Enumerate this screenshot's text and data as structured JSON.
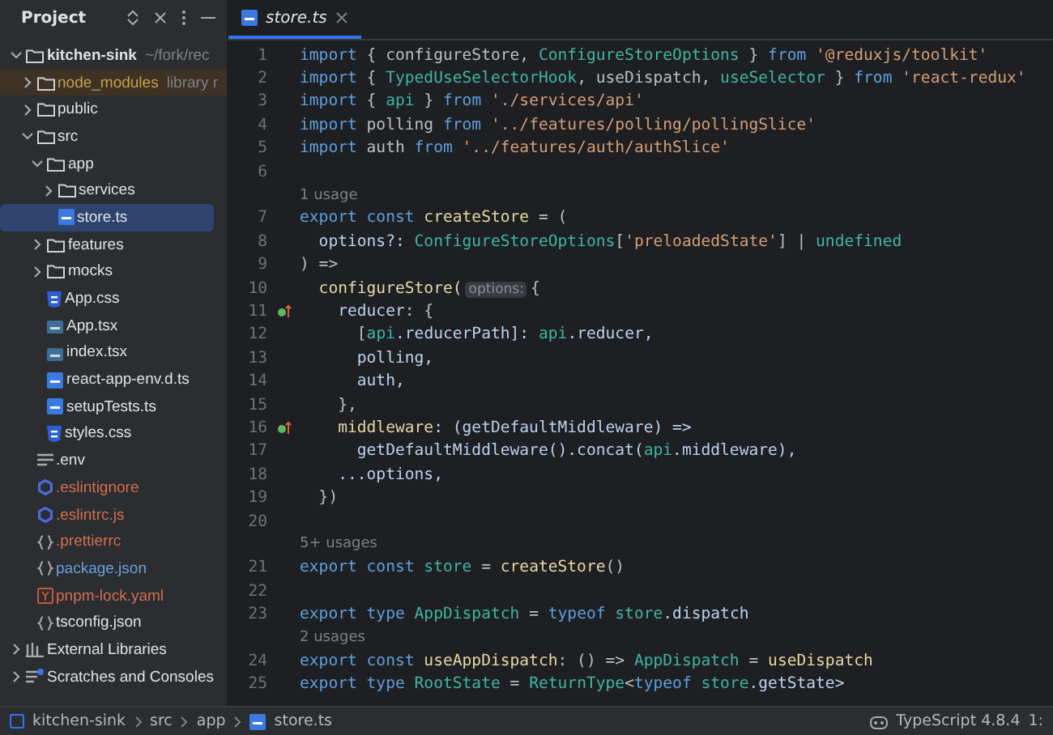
{
  "project_panel": {
    "title": "Project",
    "tree": [
      {
        "label": "kitchen-sink",
        "hint": "~/fork/rec",
        "kind": "folder",
        "expanded": true,
        "selected": false,
        "color": "#dfe1e5",
        "children": [
          {
            "label": "node_modules",
            "hint": "library r",
            "kind": "folder",
            "expanded": false,
            "selected": false,
            "excluded": true,
            "color": "#c4a24f"
          },
          {
            "label": "public",
            "kind": "folder",
            "expanded": false,
            "selected": false,
            "color": "#dfe1e5"
          },
          {
            "label": "src",
            "kind": "folder",
            "expanded": true,
            "selected": false,
            "color": "#dfe1e5",
            "children": [
              {
                "label": "app",
                "kind": "folder",
                "expanded": true,
                "selected": false,
                "color": "#dfe1e5",
                "children": [
                  {
                    "label": "services",
                    "kind": "folder",
                    "expanded": false,
                    "selected": false,
                    "color": "#dfe1e5"
                  },
                  {
                    "label": "store.ts",
                    "kind": "ts",
                    "selected": true,
                    "color": "#dfe1e5"
                  }
                ]
              },
              {
                "label": "features",
                "kind": "folder",
                "expanded": false,
                "selected": false,
                "color": "#dfe1e5"
              },
              {
                "label": "mocks",
                "kind": "folder",
                "expanded": false,
                "selected": false,
                "color": "#dfe1e5"
              },
              {
                "label": "App.css",
                "kind": "css",
                "selected": false,
                "color": "#dfe1e5"
              },
              {
                "label": "App.tsx",
                "kind": "tsx",
                "selected": false,
                "color": "#dfe1e5"
              },
              {
                "label": "index.tsx",
                "kind": "tsx",
                "selected": false,
                "color": "#dfe1e5"
              },
              {
                "label": "react-app-env.d.ts",
                "kind": "ts",
                "selected": false,
                "color": "#dfe1e5"
              },
              {
                "label": "setupTests.ts",
                "kind": "ts",
                "selected": false,
                "color": "#dfe1e5"
              },
              {
                "label": "styles.css",
                "kind": "css",
                "selected": false,
                "color": "#dfe1e5"
              }
            ]
          },
          {
            "label": ".env",
            "kind": "text",
            "selected": false,
            "color": "#dfe1e5"
          },
          {
            "label": ".eslintignore",
            "kind": "eslint",
            "selected": false,
            "color": "#d2704f"
          },
          {
            "label": ".eslintrc.js",
            "kind": "eslint",
            "selected": false,
            "color": "#d2704f"
          },
          {
            "label": ".prettierrc",
            "kind": "json",
            "selected": false,
            "color": "#d2704f"
          },
          {
            "label": "package.json",
            "kind": "json",
            "selected": false,
            "color": "#6c9fe0"
          },
          {
            "label": "pnpm-lock.yaml",
            "kind": "yaml",
            "selected": false,
            "color": "#d2704f"
          },
          {
            "label": "tsconfig.json",
            "kind": "json",
            "selected": false,
            "color": "#dfe1e5"
          }
        ]
      },
      {
        "label": "External Libraries",
        "kind": "library",
        "expanded": false,
        "selected": false,
        "color": "#dfe1e5"
      },
      {
        "label": "Scratches and Consoles",
        "kind": "scratch",
        "expanded": false,
        "selected": false,
        "color": "#dfe1e5"
      }
    ]
  },
  "editor_tabs": [
    {
      "label": "store.ts",
      "selected": true
    }
  ],
  "code": [
    {
      "kind": "code",
      "number": "1",
      "marker": false,
      "tokens": [
        {
          "text": "import",
          "kind": "kw"
        },
        {
          "text": " { configureStore, ",
          "kind": "plain"
        },
        {
          "text": "ConfigureStoreOptions",
          "kind": "type"
        },
        {
          "text": " } ",
          "kind": "plain"
        },
        {
          "text": "from",
          "kind": "kw"
        },
        {
          "text": " '@reduxjs/toolkit'",
          "kind": "str"
        }
      ]
    },
    {
      "kind": "code",
      "number": "2",
      "marker": false,
      "tokens": [
        {
          "text": "import",
          "kind": "kw"
        },
        {
          "text": " { ",
          "kind": "plain"
        },
        {
          "text": "TypedUseSelectorHook",
          "kind": "type"
        },
        {
          "text": ", useDispatch, ",
          "kind": "plain"
        },
        {
          "text": "useSelector",
          "kind": "type"
        },
        {
          "text": " } ",
          "kind": "plain"
        },
        {
          "text": "from",
          "kind": "kw"
        },
        {
          "text": " 'react-redux'",
          "kind": "str"
        }
      ]
    },
    {
      "kind": "code",
      "number": "3",
      "marker": false,
      "tokens": [
        {
          "text": "import",
          "kind": "kw"
        },
        {
          "text": " { ",
          "kind": "plain"
        },
        {
          "text": "api",
          "kind": "type"
        },
        {
          "text": " } ",
          "kind": "plain"
        },
        {
          "text": "from",
          "kind": "kw"
        },
        {
          "text": " './services/api'",
          "kind": "str"
        }
      ]
    },
    {
      "kind": "code",
      "number": "4",
      "marker": false,
      "tokens": [
        {
          "text": "import",
          "kind": "kw"
        },
        {
          "text": " polling ",
          "kind": "plain"
        },
        {
          "text": "from",
          "kind": "kw"
        },
        {
          "text": " '../features/polling/pollingSlice'",
          "kind": "str"
        }
      ]
    },
    {
      "kind": "code",
      "number": "5",
      "marker": false,
      "tokens": [
        {
          "text": "import",
          "kind": "kw"
        },
        {
          "text": " auth ",
          "kind": "plain"
        },
        {
          "text": "from",
          "kind": "kw"
        },
        {
          "text": " '../features/auth/authSlice'",
          "kind": "str"
        }
      ]
    },
    {
      "kind": "code",
      "number": "6",
      "marker": false
    },
    {
      "kind": "hint",
      "text": "1 usage"
    },
    {
      "kind": "code",
      "number": "7",
      "marker": false,
      "tokens": [
        {
          "text": "export const",
          "kind": "kw"
        },
        {
          "text": " createStore",
          "kind": "fn"
        },
        {
          "text": " = (",
          "kind": "plain"
        }
      ]
    },
    {
      "kind": "code",
      "number": "8",
      "marker": false,
      "tokens": [
        {
          "text": "  options?: ",
          "kind": "prop"
        },
        {
          "text": "ConfigureStoreOptions",
          "kind": "type"
        },
        {
          "text": "[",
          "kind": "plain"
        },
        {
          "text": "'preloadedState'",
          "kind": "str"
        },
        {
          "text": "] | ",
          "kind": "plain"
        },
        {
          "text": "undefined",
          "kind": "type"
        }
      ]
    },
    {
      "kind": "code",
      "number": "9",
      "marker": false,
      "tokens": [
        {
          "text": ") =>",
          "kind": "plain"
        }
      ]
    },
    {
      "kind": "code",
      "number": "10",
      "marker": false,
      "tokens": [
        {
          "text": "  configureStore(",
          "kind": "fn"
        },
        {
          "text": "options:",
          "kind": "inlay"
        },
        {
          "text": "{",
          "kind": "plain"
        }
      ]
    },
    {
      "kind": "code",
      "number": "11",
      "marker": true,
      "tokens": [
        {
          "text": "    reducer",
          "kind": "prop"
        },
        {
          "text": ": {",
          "kind": "plain"
        }
      ]
    },
    {
      "kind": "code",
      "number": "12",
      "marker": false,
      "tokens": [
        {
          "text": "      [",
          "kind": "plain"
        },
        {
          "text": "api",
          "kind": "type"
        },
        {
          "text": ".reducerPath]: ",
          "kind": "prop"
        },
        {
          "text": "api",
          "kind": "type"
        },
        {
          "text": ".reducer,",
          "kind": "prop"
        }
      ]
    },
    {
      "kind": "code",
      "number": "13",
      "marker": false,
      "tokens": [
        {
          "text": "      polling,",
          "kind": "prop"
        }
      ]
    },
    {
      "kind": "code",
      "number": "14",
      "marker": false,
      "tokens": [
        {
          "text": "      auth,",
          "kind": "prop"
        }
      ]
    },
    {
      "kind": "code",
      "number": "15",
      "marker": false,
      "tokens": [
        {
          "text": "    },",
          "kind": "plain"
        }
      ]
    },
    {
      "kind": "code",
      "number": "16",
      "marker": true,
      "tokens": [
        {
          "text": "    middleware",
          "kind": "fn"
        },
        {
          "text": ": (getDefaultMiddleware) =>",
          "kind": "prop"
        }
      ]
    },
    {
      "kind": "code",
      "number": "17",
      "marker": false,
      "tokens": [
        {
          "text": "      getDefaultMiddleware().concat(",
          "kind": "prop"
        },
        {
          "text": "api",
          "kind": "type"
        },
        {
          "text": ".middleware),",
          "kind": "prop"
        }
      ]
    },
    {
      "kind": "code",
      "number": "18",
      "marker": false,
      "tokens": [
        {
          "text": "    ...options,",
          "kind": "prop"
        }
      ]
    },
    {
      "kind": "code",
      "number": "19",
      "marker": false,
      "tokens": [
        {
          "text": "  })",
          "kind": "plain"
        }
      ]
    },
    {
      "kind": "code",
      "number": "20",
      "marker": false
    },
    {
      "kind": "hint",
      "text": "5+ usages"
    },
    {
      "kind": "code",
      "number": "21",
      "marker": false,
      "tokens": [
        {
          "text": "export const",
          "kind": "kw"
        },
        {
          "text": " store",
          "kind": "type"
        },
        {
          "text": " = ",
          "kind": "plain"
        },
        {
          "text": "createStore",
          "kind": "fn"
        },
        {
          "text": "()",
          "kind": "plain"
        }
      ]
    },
    {
      "kind": "code",
      "number": "22",
      "marker": false
    },
    {
      "kind": "code",
      "number": "23",
      "marker": false,
      "tokens": [
        {
          "text": "export type",
          "kind": "kw"
        },
        {
          "text": " AppDispatch",
          "kind": "type"
        },
        {
          "text": " = ",
          "kind": "plain"
        },
        {
          "text": "typeof",
          "kind": "kw"
        },
        {
          "text": " store",
          "kind": "type"
        },
        {
          "text": ".dispatch",
          "kind": "prop"
        }
      ]
    },
    {
      "kind": "hint",
      "text": "2 usages"
    },
    {
      "kind": "code",
      "number": "24",
      "marker": false,
      "tokens": [
        {
          "text": "export const",
          "kind": "kw"
        },
        {
          "text": " useAppDispatch",
          "kind": "fn"
        },
        {
          "text": ": () => ",
          "kind": "plain"
        },
        {
          "text": "AppDispatch",
          "kind": "type"
        },
        {
          "text": " = ",
          "kind": "plain"
        },
        {
          "text": "useDispatch",
          "kind": "fn"
        }
      ]
    },
    {
      "kind": "code",
      "number": "25",
      "marker": false,
      "tokens": [
        {
          "text": "export type",
          "kind": "kw"
        },
        {
          "text": " RootState",
          "kind": "type"
        },
        {
          "text": " = ",
          "kind": "plain"
        },
        {
          "text": "ReturnType",
          "kind": "type"
        },
        {
          "text": "<",
          "kind": "plain"
        },
        {
          "text": "typeof",
          "kind": "kw"
        },
        {
          "text": " store",
          "kind": "type"
        },
        {
          "text": ".getState>",
          "kind": "prop"
        }
      ]
    }
  ],
  "status_bar": {
    "breadcrumbs": [
      {
        "label": "kitchen-sink",
        "kind": "module"
      },
      {
        "label": "src",
        "kind": "folder"
      },
      {
        "label": "app",
        "kind": "folder"
      },
      {
        "label": "store.ts",
        "kind": "ts"
      }
    ],
    "language": "TypeScript 4.8.4",
    "position": "1:"
  }
}
